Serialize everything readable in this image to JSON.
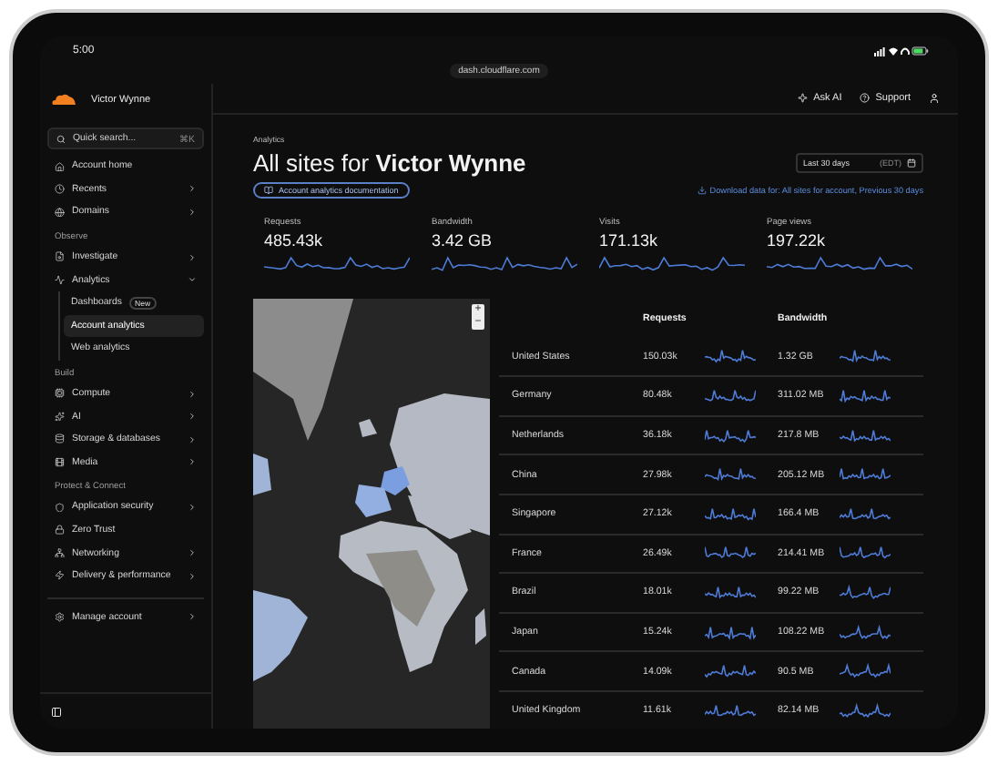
{
  "status_bar": {
    "time": "5:00"
  },
  "browser": {
    "url": "dash.cloudflare.com"
  },
  "header": {
    "account": "Victor Wynne",
    "actions": [
      {
        "label": "Ask AI",
        "kind": "ai"
      },
      {
        "label": "Support",
        "kind": "support"
      }
    ]
  },
  "sidebar": {
    "search": {
      "placeholder": "Quick search...",
      "shortcut": "⌘K"
    },
    "sections": [
      {
        "items": [
          {
            "label": "Account home",
            "submenu": false,
            "selected": false
          },
          {
            "label": "Recents",
            "submenu": true,
            "expanded": false,
            "selected": false
          },
          {
            "label": "Domains",
            "submenu": true,
            "expanded": false,
            "selected": false
          }
        ]
      },
      {
        "title": "Observe",
        "items": [
          {
            "label": "Investigate",
            "submenu": true,
            "expanded": false,
            "selected": false
          },
          {
            "label": "Analytics",
            "submenu": true,
            "expanded": true,
            "selected": false,
            "children": [
              {
                "label": "Dashboards",
                "badge": "New",
                "selected": false
              },
              {
                "label": "Account analytics",
                "selected": true
              },
              {
                "label": "Web analytics",
                "selected": false
              }
            ]
          }
        ]
      },
      {
        "title": "Build",
        "items": [
          {
            "label": "Compute",
            "submenu": true,
            "expanded": false,
            "selected": false
          },
          {
            "label": "AI",
            "submenu": true,
            "expanded": false,
            "selected": false
          },
          {
            "label": "Storage & databases",
            "submenu": true,
            "expanded": false,
            "selected": false
          },
          {
            "label": "Media",
            "submenu": true,
            "expanded": false,
            "selected": false
          }
        ]
      },
      {
        "title": "Protect & Connect",
        "items": [
          {
            "label": "Application security",
            "submenu": true,
            "expanded": false,
            "selected": false
          },
          {
            "label": "Zero Trust",
            "submenu": false,
            "selected": false
          },
          {
            "label": "Networking",
            "submenu": true,
            "expanded": false,
            "selected": false
          },
          {
            "label": "Delivery & performance",
            "submenu": true,
            "expanded": false,
            "selected": false
          }
        ]
      },
      {
        "divider": true,
        "items": [
          {
            "label": "Manage account",
            "submenu": true,
            "expanded": false,
            "selected": false
          }
        ]
      }
    ]
  },
  "main": {
    "breadcrumb": "Analytics",
    "title": "All sites for **Victor Wynne**",
    "doc_link": "Account analytics documentation",
    "date_range": {
      "value": "Last 30 days",
      "timezone": "(EDT)"
    },
    "download_link": "Download data for: All sites for account, Previous 30 days",
    "stats": [
      {
        "label": "Requests",
        "value": "485.43k"
      },
      {
        "label": "Bandwidth",
        "value": "3.42 GB"
      },
      {
        "label": "Visits",
        "value": "171.13k"
      },
      {
        "label": "Page views",
        "value": "197.22k"
      }
    ],
    "map": {
      "kind": "picture",
      "zoom": [
        "+",
        "−"
      ]
    },
    "table": {
      "columns": [
        "Requests",
        "Bandwidth"
      ],
      "rows": [
        {
          "country": "United States",
          "requests": "150.03k",
          "bandwidth": "1.32 GB"
        },
        {
          "country": "Germany",
          "requests": "80.48k",
          "bandwidth": "311.02 MB"
        },
        {
          "country": "Netherlands",
          "requests": "36.18k",
          "bandwidth": "217.8 MB"
        },
        {
          "country": "China",
          "requests": "27.98k",
          "bandwidth": "205.12 MB"
        },
        {
          "country": "Singapore",
          "requests": "27.12k",
          "bandwidth": "166.4 MB"
        },
        {
          "country": "France",
          "requests": "26.49k",
          "bandwidth": "214.41 MB"
        },
        {
          "country": "Brazil",
          "requests": "18.01k",
          "bandwidth": "99.22 MB"
        },
        {
          "country": "Japan",
          "requests": "15.24k",
          "bandwidth": "108.22 MB"
        },
        {
          "country": "Canada",
          "requests": "14.09k",
          "bandwidth": "90.5 MB"
        },
        {
          "country": "United Kingdom",
          "requests": "11.61k",
          "bandwidth": "82.14 MB"
        }
      ]
    }
  }
}
